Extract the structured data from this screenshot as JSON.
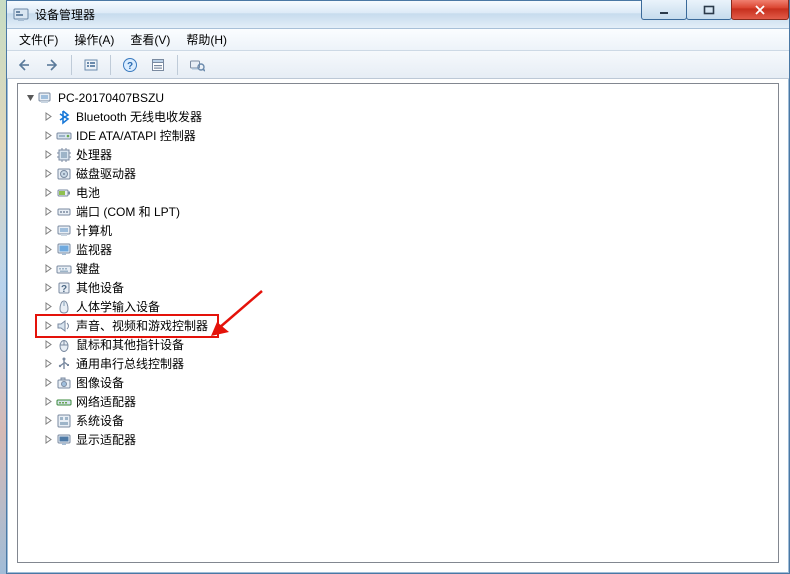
{
  "window": {
    "title": "设备管理器"
  },
  "menu": {
    "file": "文件(F)",
    "action": "操作(A)",
    "view": "查看(V)",
    "help": "帮助(H)"
  },
  "root": {
    "label": "PC-20170407BSZU"
  },
  "nodes": [
    {
      "key": "bluetooth",
      "label": "Bluetooth 无线电收发器"
    },
    {
      "key": "ide",
      "label": "IDE ATA/ATAPI 控制器"
    },
    {
      "key": "cpu",
      "label": "处理器"
    },
    {
      "key": "disk",
      "label": "磁盘驱动器"
    },
    {
      "key": "battery",
      "label": "电池"
    },
    {
      "key": "ports",
      "label": "端口 (COM 和 LPT)"
    },
    {
      "key": "computer",
      "label": "计算机"
    },
    {
      "key": "monitor",
      "label": "监视器"
    },
    {
      "key": "keyboard",
      "label": "键盘"
    },
    {
      "key": "other",
      "label": "其他设备"
    },
    {
      "key": "hid",
      "label": "人体学输入设备"
    },
    {
      "key": "sound",
      "label": "声音、视频和游戏控制器"
    },
    {
      "key": "mouse",
      "label": "鼠标和其他指针设备"
    },
    {
      "key": "usb",
      "label": "通用串行总线控制器"
    },
    {
      "key": "imaging",
      "label": "图像设备"
    },
    {
      "key": "network",
      "label": "网络适配器"
    },
    {
      "key": "system",
      "label": "系统设备"
    },
    {
      "key": "display",
      "label": "显示适配器"
    }
  ],
  "annotation": {
    "highlighted_key": "sound"
  }
}
